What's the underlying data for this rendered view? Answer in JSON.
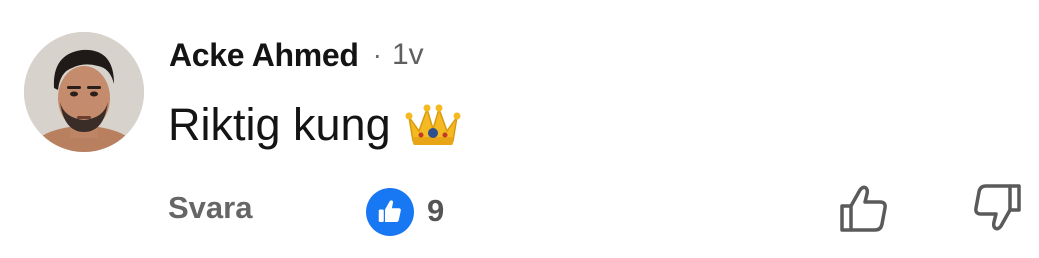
{
  "comment": {
    "author": "Acke Ahmed",
    "separator": "·",
    "time": "1v",
    "text": "Riktig kung",
    "emoji_icon": "crown-icon"
  },
  "actions": {
    "reply_label": "Svara",
    "reaction_icon": "thumbs-up-icon",
    "reaction_count": "9",
    "like_icon": "thumbs-up-outline-icon",
    "dislike_icon": "thumbs-down-outline-icon"
  },
  "colors": {
    "reaction_badge": "#1877f2",
    "muted_text": "#666666"
  }
}
